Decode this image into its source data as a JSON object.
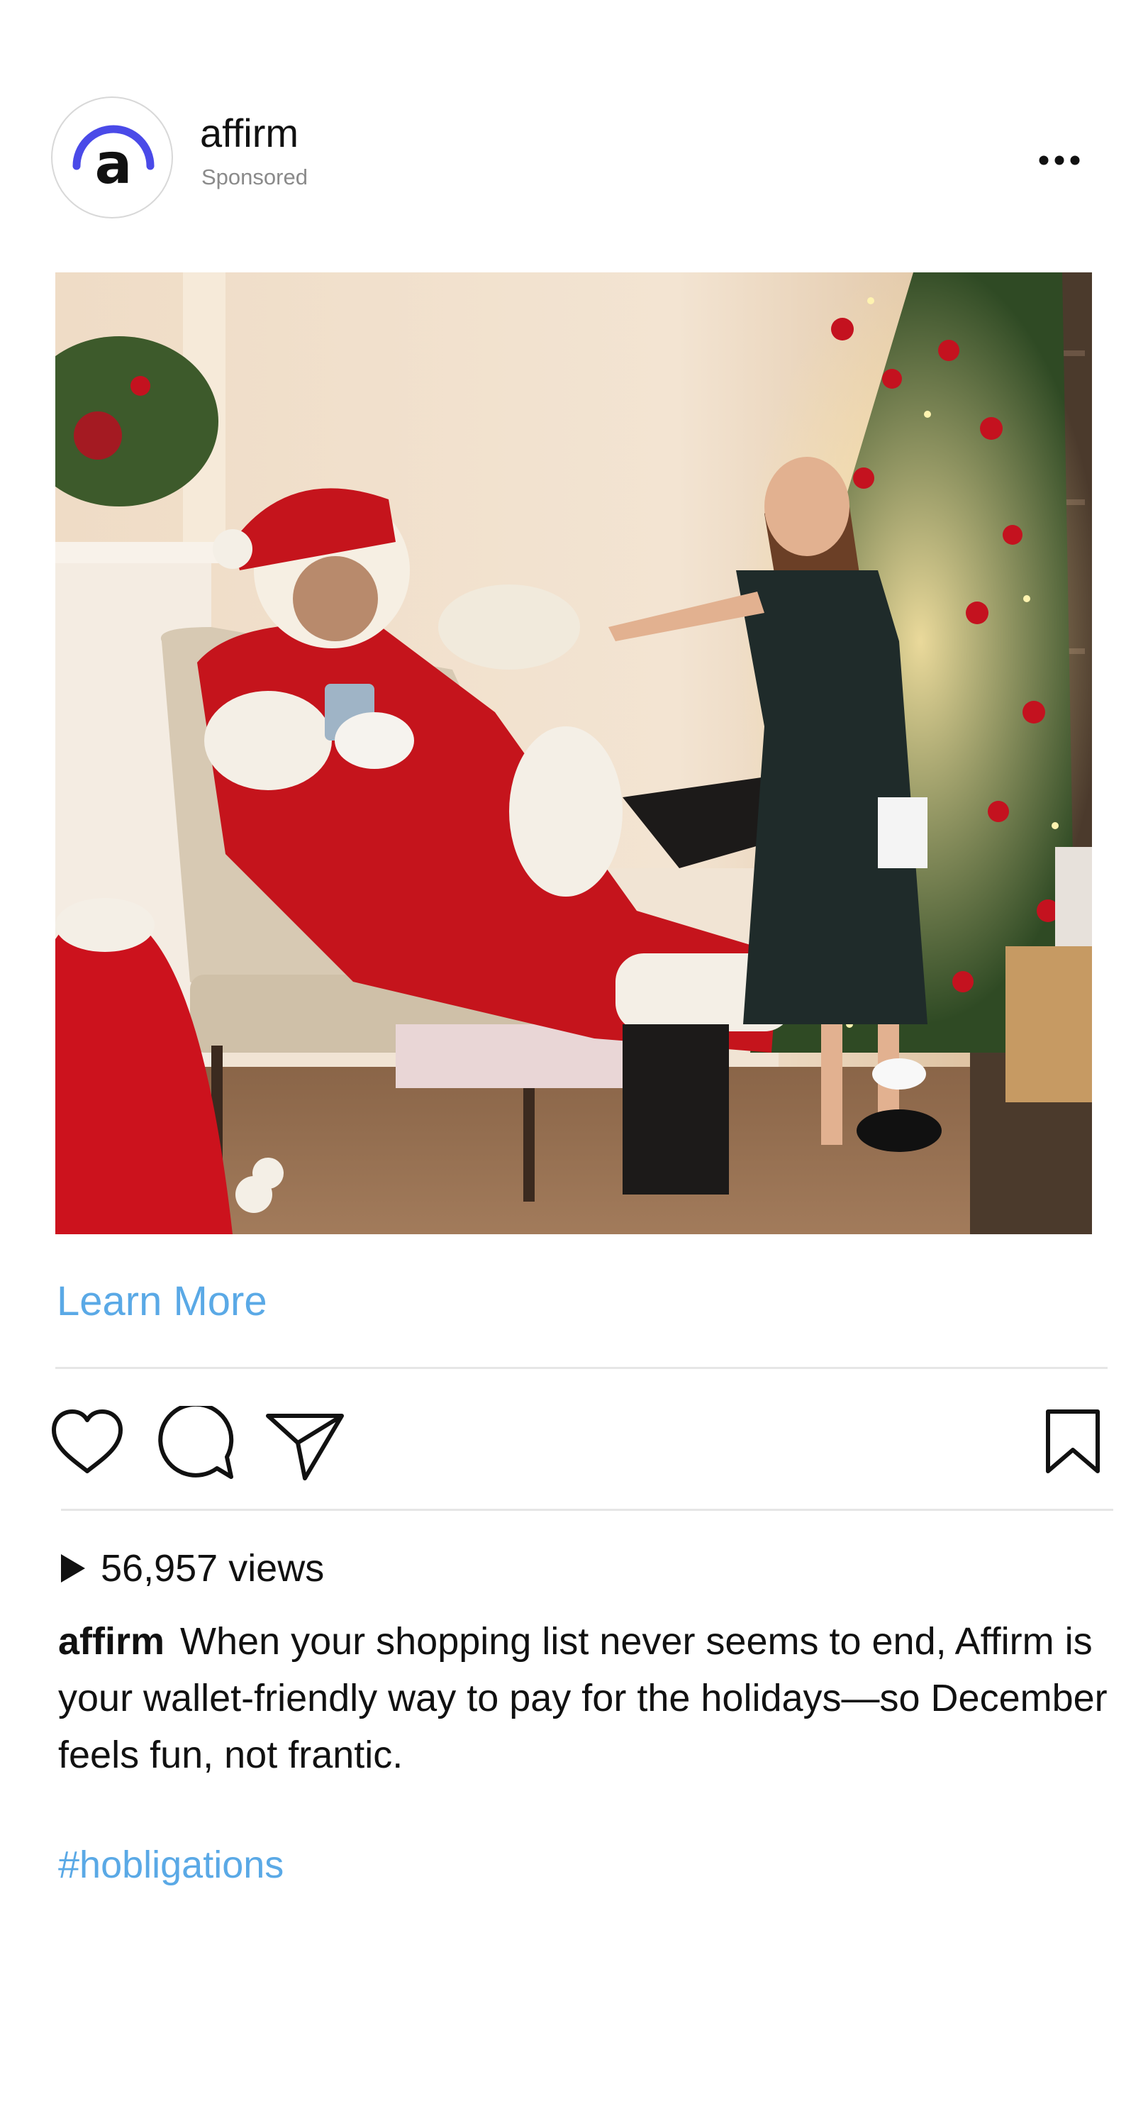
{
  "post": {
    "account_name": "affirm",
    "sponsored_label": "Sponsored",
    "avatar_letter": "a",
    "cta_label": "Learn More",
    "views_count": "56,957",
    "views_suffix": "views",
    "caption_username": "affirm",
    "caption_text": "When your shopping list never seems to end, Affirm is your wallet-friendly way to pay for the holidays—so December feels fun, not frantic.",
    "hashtag": "#hobligations"
  },
  "icons": {
    "more": "more-options-icon",
    "like": "heart-icon",
    "comment": "comment-bubble-icon",
    "share": "paper-plane-icon",
    "save": "bookmark-icon",
    "views": "play-icon"
  },
  "colors": {
    "brand_accent": "#4a4ae8",
    "link": "#5aa9e6",
    "text": "#111111",
    "secondary_text": "#8a8a8a",
    "divider": "#e6e6e6"
  }
}
